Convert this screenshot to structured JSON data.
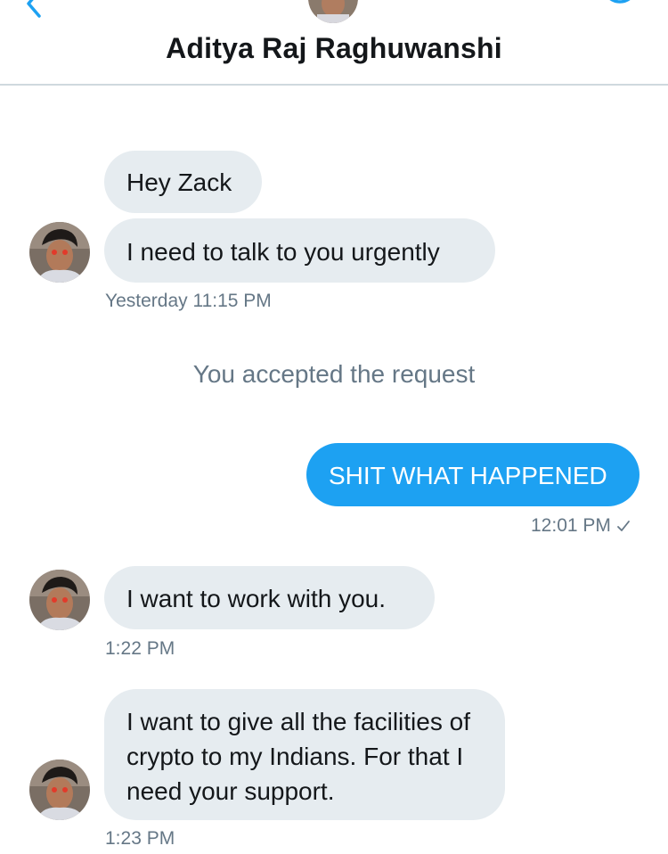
{
  "header": {
    "title": "Aditya Raj Raghuwanshi",
    "back_icon": "chevron-left-icon",
    "info_icon": "info-icon"
  },
  "colors": {
    "accent": "#1da1f2",
    "received_bubble": "#e6ecf0",
    "muted_text": "#657786"
  },
  "messages": [
    {
      "direction": "received",
      "text": "Hey Zack"
    },
    {
      "direction": "received",
      "text": "I need to talk to you urgently"
    },
    {
      "direction": "received",
      "timestamp": "Yesterday 11:15 PM"
    }
  ],
  "system": {
    "note": "You accepted the request"
  },
  "sent": {
    "text": "SHIT WHAT HAPPENED",
    "timestamp": "12:01 PM",
    "status_icon": "checkmark-icon"
  },
  "received_2": {
    "text": "I want to work with you.",
    "timestamp": "1:22 PM"
  },
  "received_3": {
    "text": "I want to give all the facilities of crypto to my Indians. For that I need your support.",
    "timestamp": "1:23 PM"
  }
}
